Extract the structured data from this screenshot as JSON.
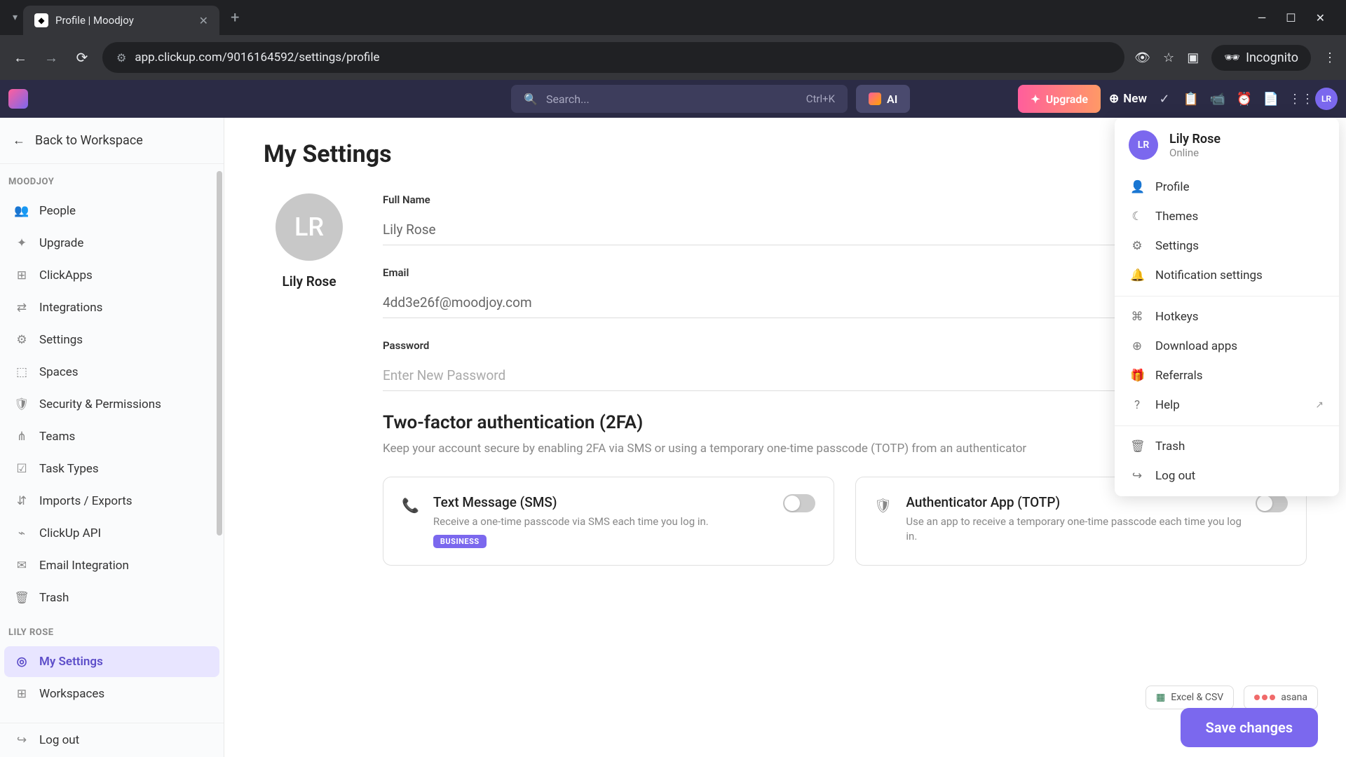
{
  "browser": {
    "tab_title": "Profile | Moodjoy",
    "url": "app.clickup.com/9016164592/settings/profile",
    "incognito": "Incognito"
  },
  "header": {
    "search_placeholder": "Search...",
    "search_shortcut": "Ctrl+K",
    "ai": "AI",
    "upgrade": "Upgrade",
    "new": "New",
    "avatar_initials": "LR"
  },
  "sidebar": {
    "back": "Back to Workspace",
    "section1": "MOODJOY",
    "section2": "LILY ROSE",
    "items1": [
      {
        "icon": "👥",
        "label": "People"
      },
      {
        "icon": "✦",
        "label": "Upgrade"
      },
      {
        "icon": "⊞",
        "label": "ClickApps"
      },
      {
        "icon": "⇄",
        "label": "Integrations"
      },
      {
        "icon": "⚙",
        "label": "Settings"
      },
      {
        "icon": "⬚",
        "label": "Spaces"
      },
      {
        "icon": "🛡",
        "label": "Security & Permissions"
      },
      {
        "icon": "⋔",
        "label": "Teams"
      },
      {
        "icon": "☑",
        "label": "Task Types"
      },
      {
        "icon": "⇵",
        "label": "Imports / Exports"
      },
      {
        "icon": "⌁",
        "label": "ClickUp API"
      },
      {
        "icon": "✉",
        "label": "Email Integration"
      },
      {
        "icon": "🗑",
        "label": "Trash"
      }
    ],
    "items2": [
      {
        "icon": "◎",
        "label": "My Settings"
      },
      {
        "icon": "⊞",
        "label": "Workspaces"
      }
    ],
    "logout": "Log out"
  },
  "main": {
    "title": "My Settings",
    "avatar_initials": "LR",
    "profile_name": "Lily Rose",
    "full_name_label": "Full Name",
    "full_name_value": "Lily Rose",
    "email_label": "Email",
    "email_value": "4dd3e26f@moodjoy.com",
    "password_label": "Password",
    "password_placeholder": "Enter New Password",
    "tfa_title": "Two-factor authentication (2FA)",
    "tfa_desc": "Keep your account secure by enabling 2FA via SMS or using a temporary one-time passcode (TOTP) from an authenticator",
    "sms_title": "Text Message (SMS)",
    "sms_desc": "Receive a one-time passcode via SMS each time you log in.",
    "sms_badge": "BUSINESS",
    "totp_title": "Authenticator App (TOTP)",
    "totp_desc": "Use an app to receive a temporary one-time passcode each time you log in.",
    "excel_csv": "Excel & CSV",
    "asana": "asana",
    "save": "Save changes"
  },
  "dropdown": {
    "name": "Lily Rose",
    "status": "Online",
    "avatar_initials": "LR",
    "items": [
      {
        "icon": "👤",
        "label": "Profile"
      },
      {
        "icon": "☾",
        "label": "Themes"
      },
      {
        "icon": "⚙",
        "label": "Settings"
      },
      {
        "icon": "🔔",
        "label": "Notification settings"
      }
    ],
    "items2": [
      {
        "icon": "⌘",
        "label": "Hotkeys"
      },
      {
        "icon": "⊕",
        "label": "Download apps"
      },
      {
        "icon": "🎁",
        "label": "Referrals"
      },
      {
        "icon": "?",
        "label": "Help",
        "ext": true
      }
    ],
    "items3": [
      {
        "icon": "🗑",
        "label": "Trash"
      },
      {
        "icon": "↪",
        "label": "Log out"
      }
    ]
  }
}
